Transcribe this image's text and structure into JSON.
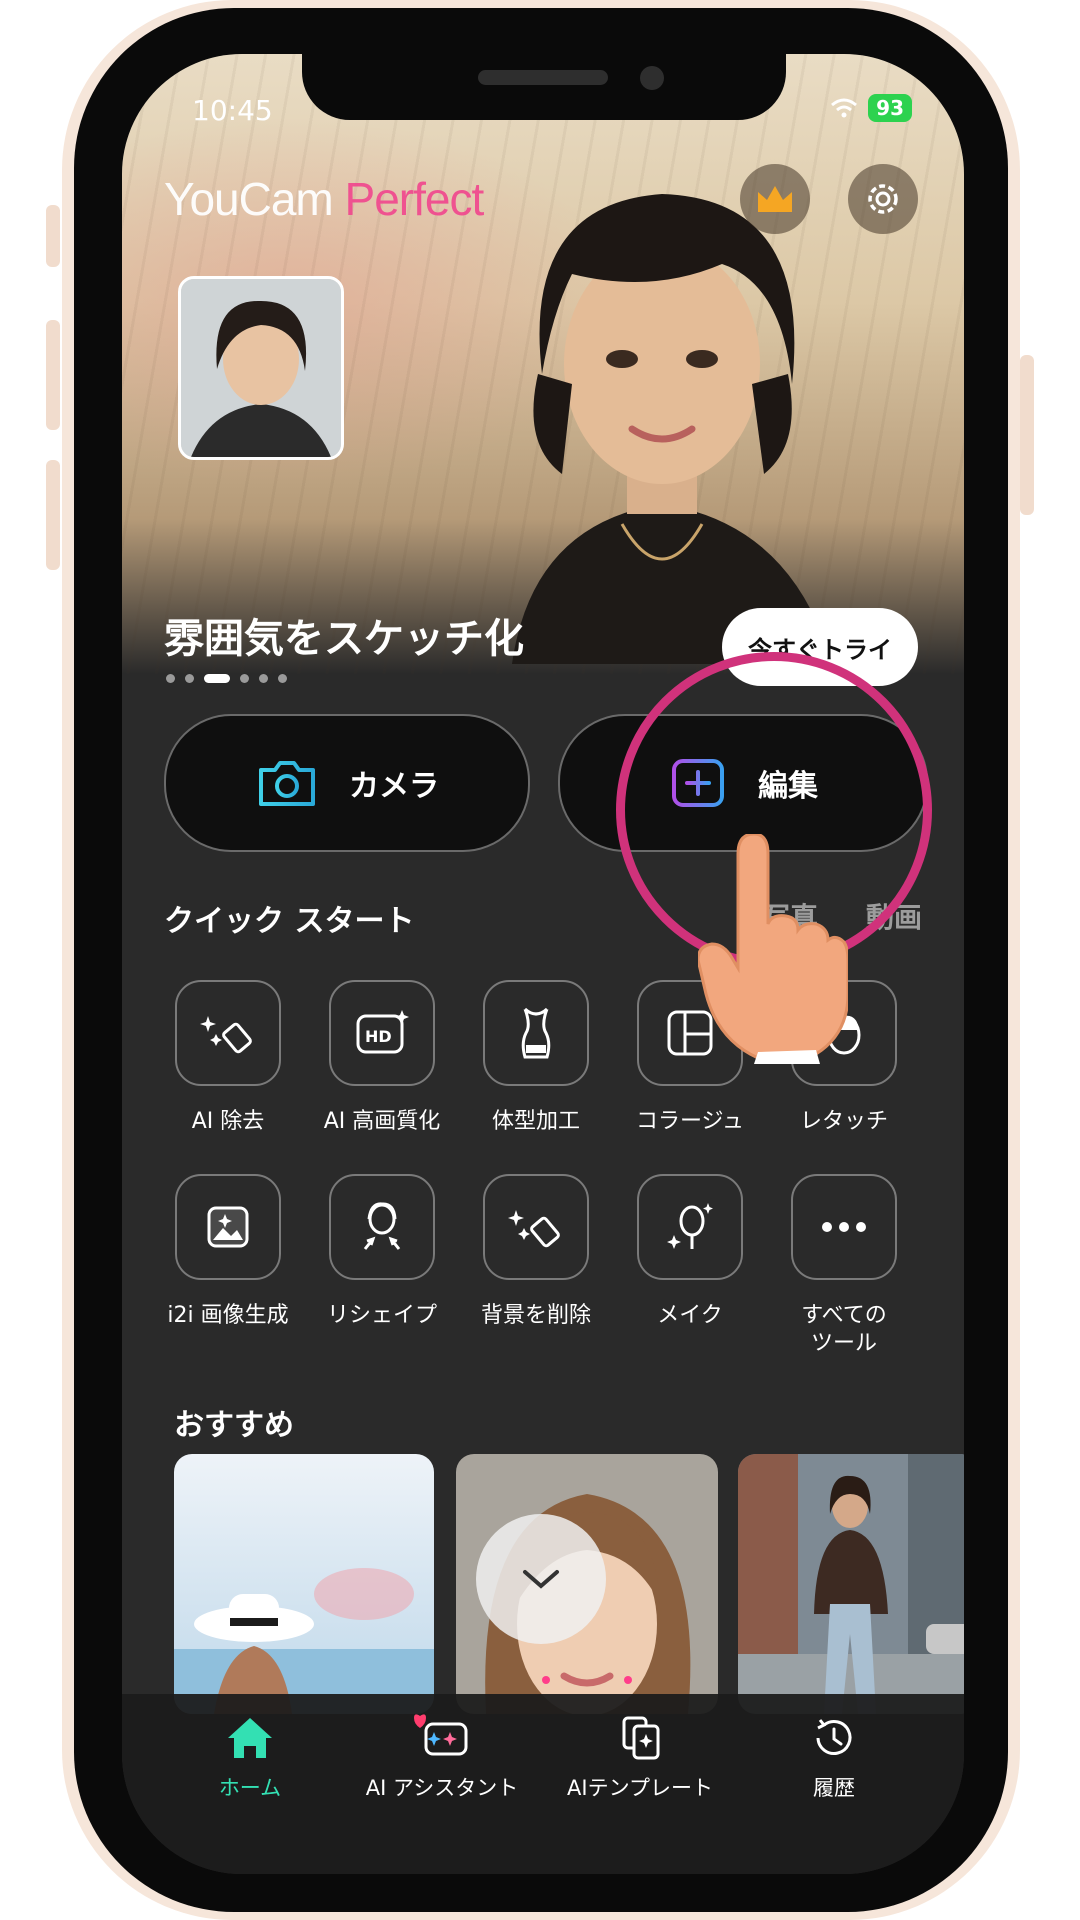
{
  "status_bar": {
    "time": "10:45",
    "battery": "93"
  },
  "brand": {
    "part1": "YouCam",
    "part2": " Perfect"
  },
  "hero": {
    "title": "雰囲気をスケッチ化",
    "try_button": "今すぐトライ",
    "slides": 6,
    "active_slide": 3
  },
  "main_actions": {
    "camera": "カメラ",
    "edit": "編集"
  },
  "quick_start": {
    "title": "クイック スタート",
    "tabs": [
      "写真",
      "動画"
    ],
    "tools": [
      {
        "label": "AI 除去",
        "icon": "eraser-sparkle-icon"
      },
      {
        "label": "AI 高画質化",
        "icon": "hd-icon"
      },
      {
        "label": "体型加工",
        "icon": "body-shape-icon"
      },
      {
        "label": "コラージュ",
        "icon": "collage-icon"
      },
      {
        "label": "レタッチ",
        "icon": "face-retouch-icon"
      },
      {
        "label": "i2i 画像生成",
        "icon": "image-generate-icon"
      },
      {
        "label": "リシェイプ",
        "icon": "reshape-icon"
      },
      {
        "label": "背景を削除",
        "icon": "remove-background-icon"
      },
      {
        "label": "メイク",
        "icon": "makeup-mirror-icon"
      },
      {
        "label": "すべての\nツール",
        "icon": "more-icon"
      }
    ]
  },
  "recommended": {
    "title": "おすすめ"
  },
  "bottom_nav": [
    {
      "label": "ホーム",
      "icon": "home-icon",
      "active": true
    },
    {
      "label": "AI アシスタント",
      "icon": "ai-assistant-icon",
      "active": false
    },
    {
      "label": "AIテンプレート",
      "icon": "ai-template-icon",
      "active": false
    },
    {
      "label": "履歴",
      "icon": "history-icon",
      "active": false
    }
  ],
  "colors": {
    "accent_pink": "#d0327b",
    "active_nav": "#33e0b3",
    "battery": "#2dd24f",
    "brand_pink": "#f04c8f"
  }
}
